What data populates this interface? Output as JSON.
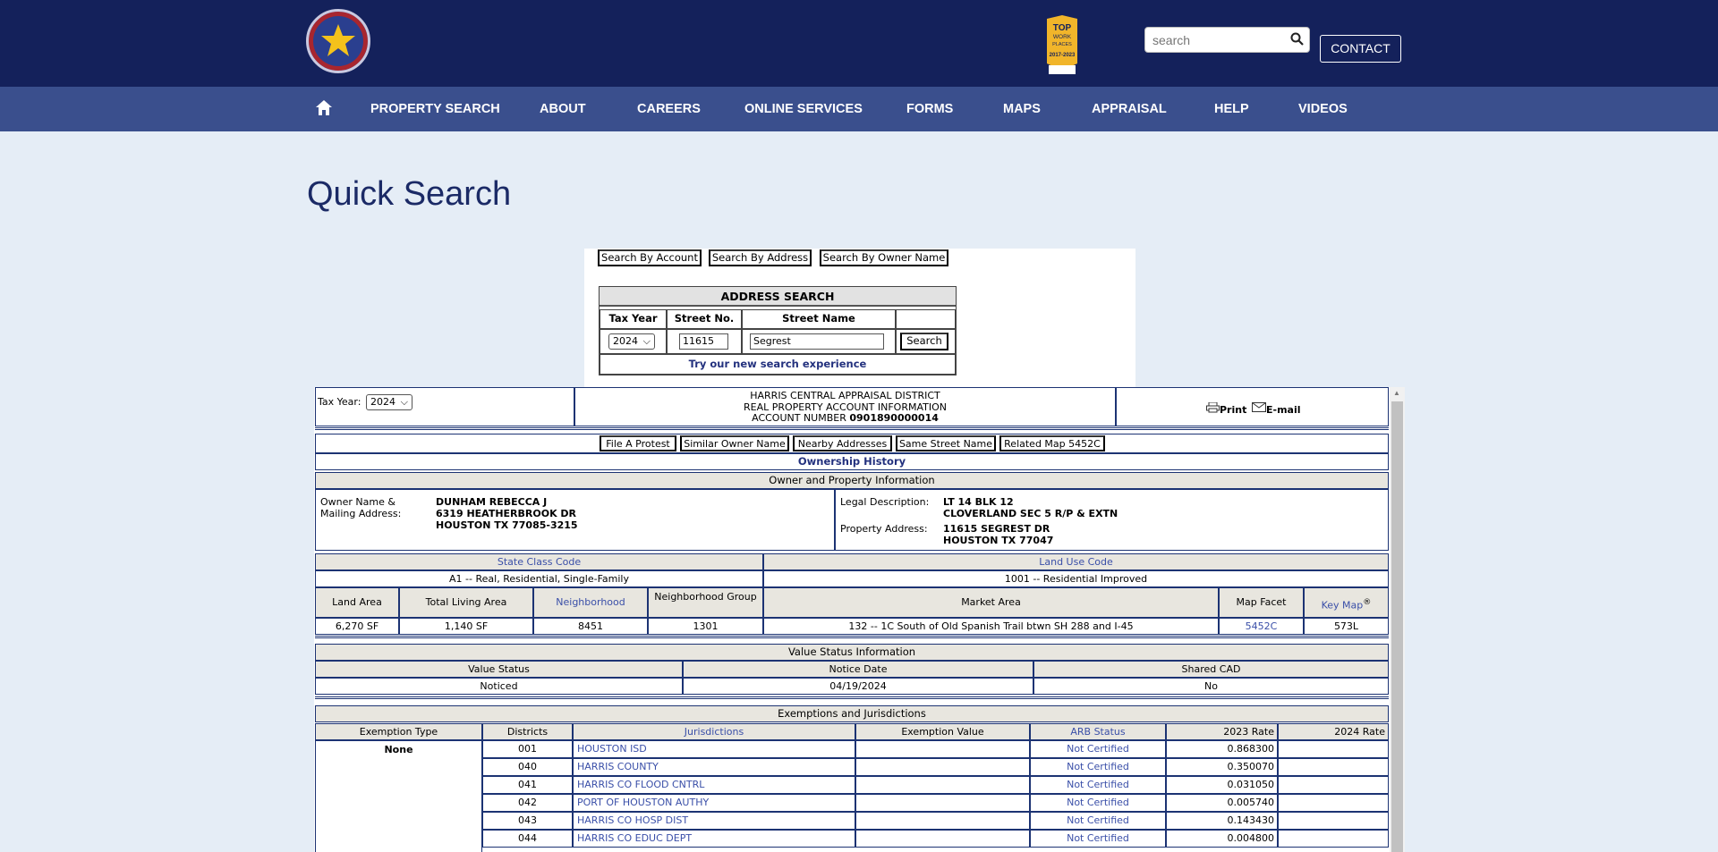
{
  "header": {
    "search_placeholder": "search",
    "contact_label": "CONTACT",
    "award_lines": [
      "TOP",
      "WORK",
      "PLACES",
      "2017-2023"
    ]
  },
  "nav": {
    "items": [
      "PROPERTY SEARCH",
      "ABOUT",
      "CAREERS",
      "ONLINE SERVICES",
      "FORMS",
      "MAPS",
      "APPRAISAL",
      "HELP",
      "VIDEOS"
    ]
  },
  "page_title": "Quick Search",
  "quick_search": {
    "buttons": [
      "Search By Account",
      "Search By Address",
      "Search By Owner Name"
    ],
    "address_search": {
      "title": "ADDRESS SEARCH",
      "col_tax_year": "Tax Year",
      "col_street_no": "Street No.",
      "col_street_name": "Street Name",
      "tax_year": "2024",
      "street_no": "11615",
      "street_name": "Segrest",
      "search_btn": "Search",
      "new_search_link": "Try our new search experience"
    }
  },
  "record": {
    "tax_year_label": "Tax Year:",
    "tax_year": "2024",
    "district_line1": "HARRIS CENTRAL APPRAISAL DISTRICT",
    "district_line2": "REAL PROPERTY ACCOUNT INFORMATION",
    "account_label": "ACCOUNT NUMBER",
    "account_number": "0901890000014",
    "print_label": "Print",
    "email_label": "E-mail",
    "action_buttons": [
      "File A Protest",
      "Similar Owner Name",
      "Nearby Addresses",
      "Same Street Name",
      "Related Map 5452C"
    ],
    "ownership_history": "Ownership History",
    "owner_section_title": "Owner and Property Information",
    "owner_label_1": "Owner Name &",
    "owner_label_2": "Mailing Address:",
    "owner_name": "DUNHAM REBECCA J",
    "owner_addr1": "6319 HEATHERBROOK DR",
    "owner_addr2": "HOUSTON TX 77085-3215",
    "legal_label": "Legal Description:",
    "legal_1": "LT 14 BLK 12",
    "legal_2": "CLOVERLAND SEC 5 R/P & EXTN",
    "prop_addr_label": "Property Address:",
    "prop_addr1": "11615 SEGREST DR",
    "prop_addr2": "HOUSTON TX 77047",
    "state_class_label": "State Class Code",
    "state_class_value": "A1 -- Real, Residential, Single-Family",
    "land_use_label": "Land Use Code",
    "land_use_value": "1001 -- Residential Improved",
    "detail_headers": [
      "Land Area",
      "Total Living Area",
      "Neighborhood",
      "Neighborhood Group",
      "Market Area",
      "Map Facet",
      "Key Map"
    ],
    "detail_values": [
      "6,270 SF",
      "1,140 SF",
      "8451",
      "1301",
      "132 -- 1C South of Old Spanish Trail btwn SH 288 and I-45",
      "5452C",
      "573L"
    ],
    "key_map_sup": "®",
    "value_status_title": "Value Status Information",
    "value_status_headers": [
      "Value Status",
      "Notice Date",
      "Shared CAD"
    ],
    "value_status_values": [
      "Noticed",
      "04/19/2024",
      "No"
    ],
    "exemptions_title": "Exemptions and Jurisdictions",
    "exemption_headers": [
      "Exemption Type",
      "Districts",
      "Jurisdictions",
      "Exemption Value",
      "ARB Status",
      "2023 Rate",
      "2024 Rate"
    ],
    "exemption_type": "None",
    "jurisdictions": [
      {
        "district": "001",
        "name": "HOUSTON ISD",
        "arb": "Not Certified",
        "rate2023": "0.868300"
      },
      {
        "district": "040",
        "name": "HARRIS COUNTY",
        "arb": "Not Certified",
        "rate2023": "0.350070"
      },
      {
        "district": "041",
        "name": "HARRIS CO FLOOD CNTRL",
        "arb": "Not Certified",
        "rate2023": "0.031050"
      },
      {
        "district": "042",
        "name": "PORT OF HOUSTON AUTHY",
        "arb": "Not Certified",
        "rate2023": "0.005740"
      },
      {
        "district": "043",
        "name": "HARRIS CO HOSP DIST",
        "arb": "Not Certified",
        "rate2023": "0.143430"
      },
      {
        "district": "044",
        "name": "HARRIS CO EDUC DEPT",
        "arb": "Not Certified",
        "rate2023": "0.004800"
      }
    ]
  }
}
